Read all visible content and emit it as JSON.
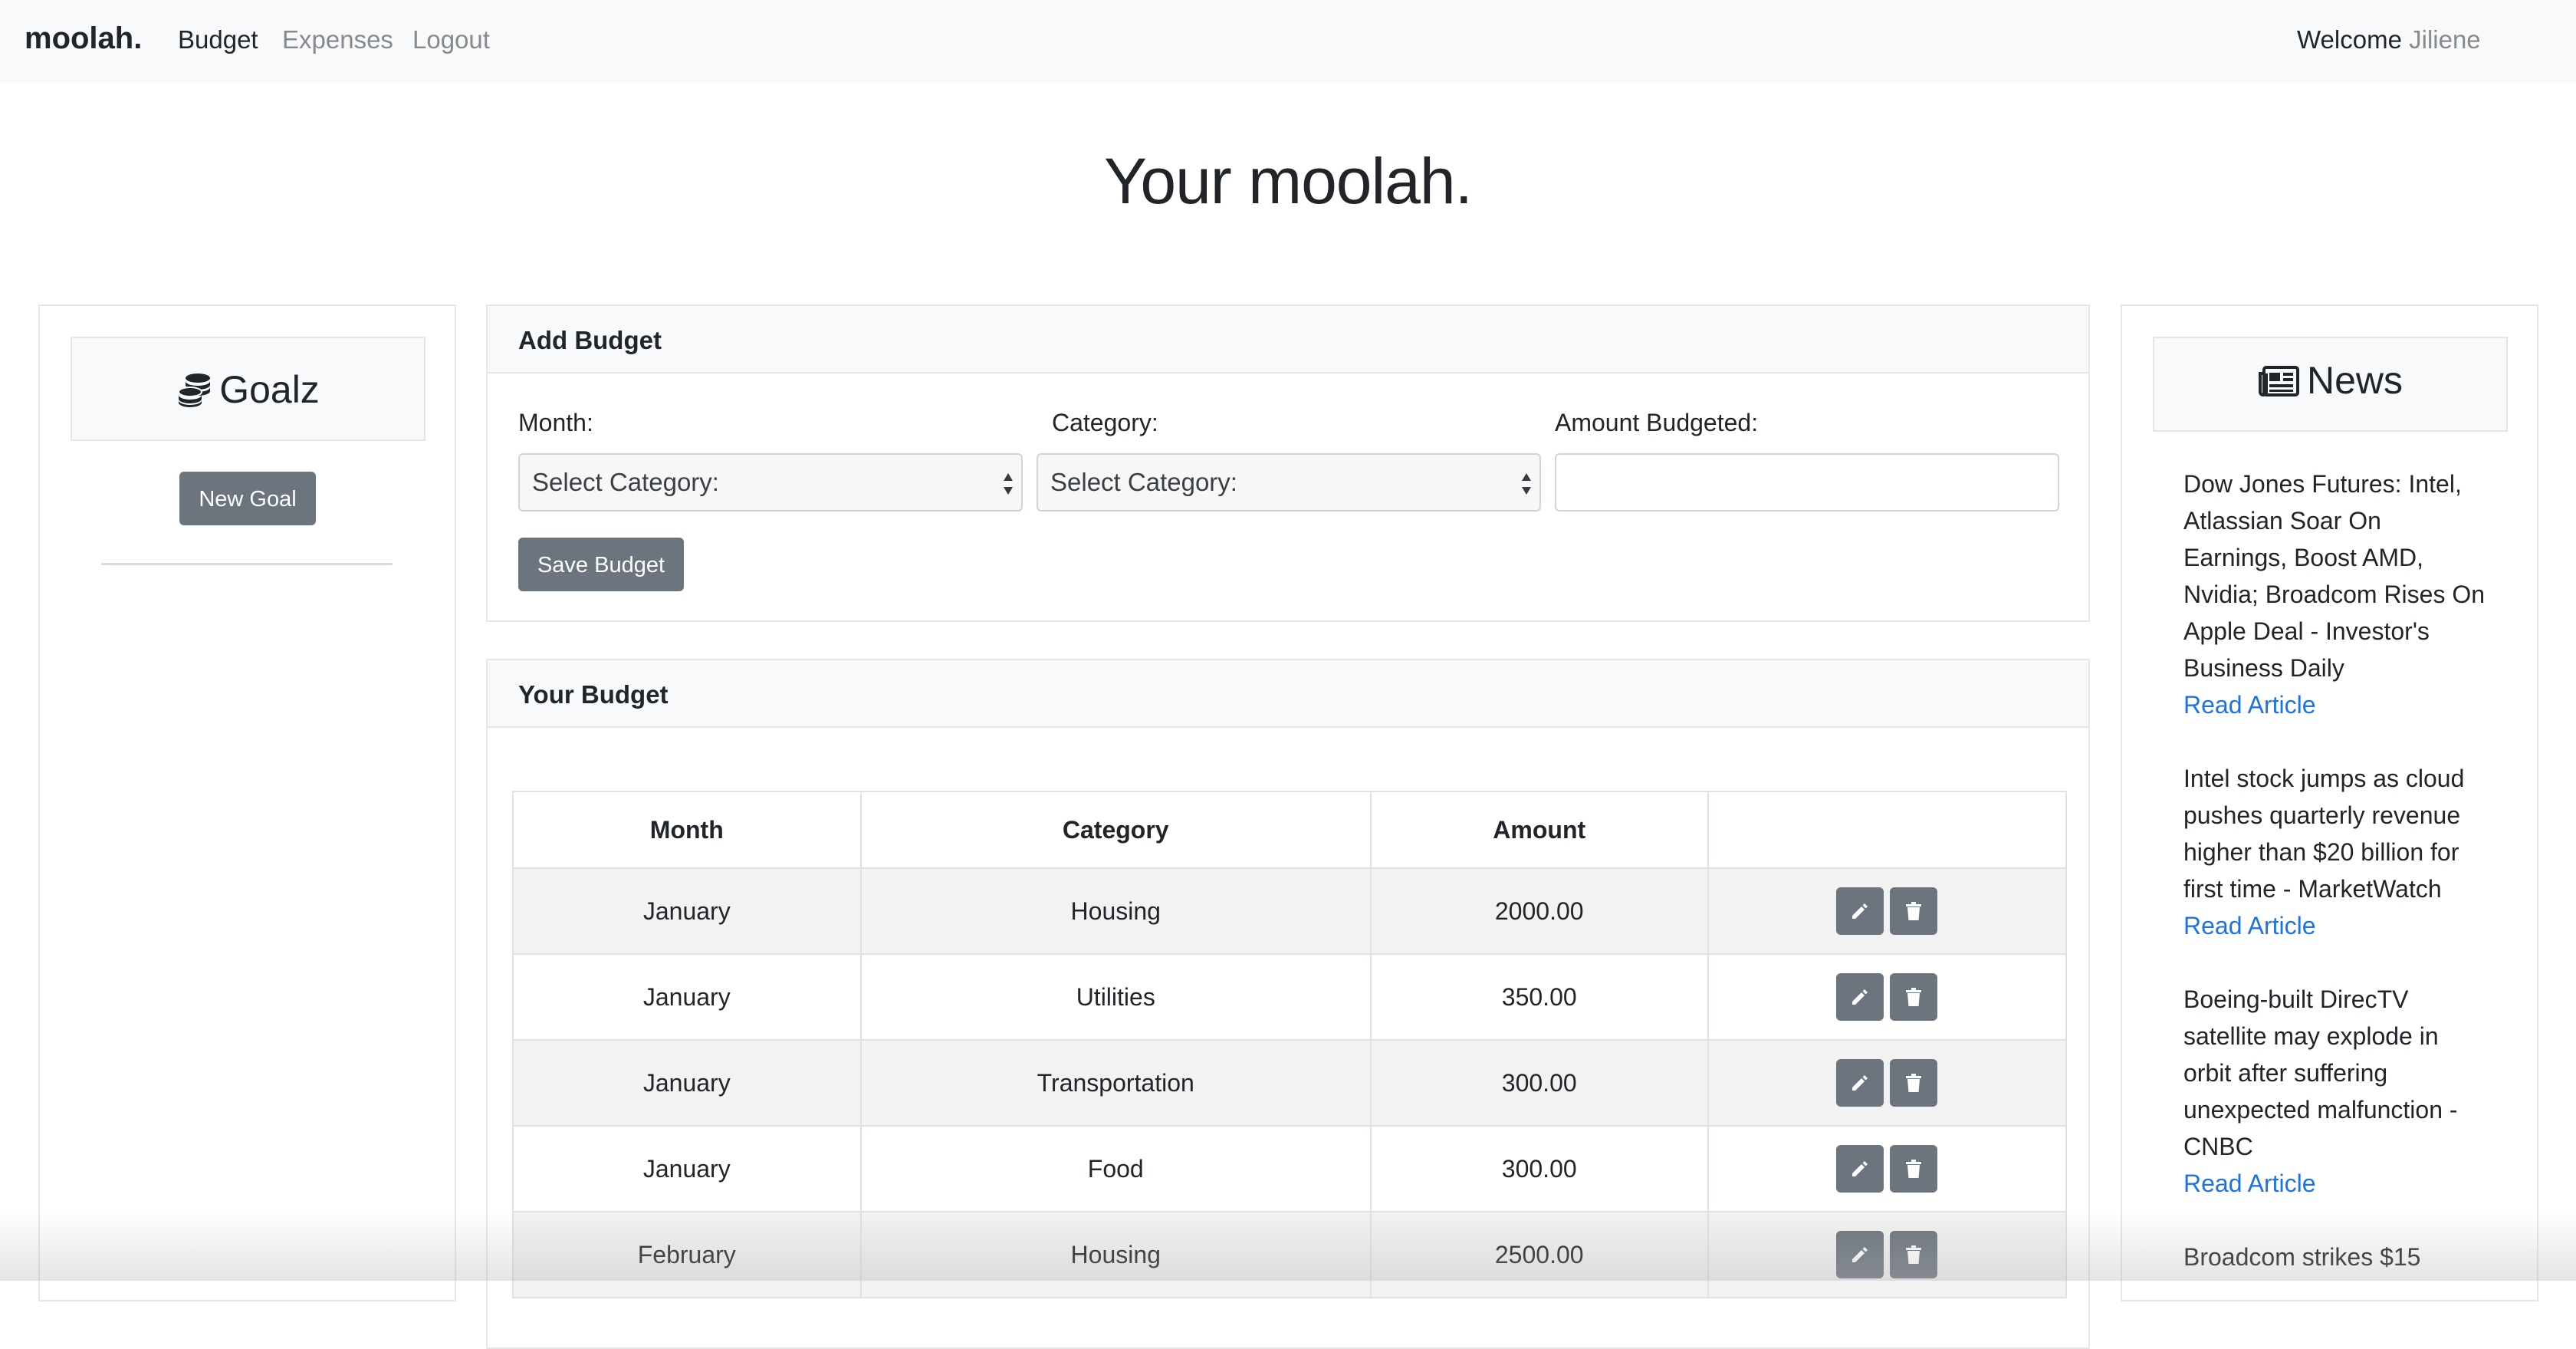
{
  "navbar": {
    "brand": "moolah.",
    "links": [
      "Budget",
      "Expenses",
      "Logout"
    ],
    "welcome_label": "Welcome",
    "username": "Jiliene"
  },
  "page_title": "Your moolah.",
  "goals": {
    "title": "Goalz",
    "new_goal_label": "New Goal"
  },
  "add_budget": {
    "title": "Add Budget",
    "month_label": "Month:",
    "month_select": "Select Category:",
    "category_label": "Category:",
    "category_select": "Select Category:",
    "amount_label": "Amount Budgeted:",
    "amount_value": "",
    "save_label": "Save Budget"
  },
  "budget": {
    "title": "Your Budget",
    "headers": [
      "Month",
      "Category",
      "Amount",
      ""
    ],
    "rows": [
      {
        "month": "January",
        "category": "Housing",
        "amount": "2000.00"
      },
      {
        "month": "January",
        "category": "Utilities",
        "amount": "350.00"
      },
      {
        "month": "January",
        "category": "Transportation",
        "amount": "300.00"
      },
      {
        "month": "January",
        "category": "Food",
        "amount": "300.00"
      },
      {
        "month": "February",
        "category": "Housing",
        "amount": "2500.00"
      }
    ]
  },
  "news": {
    "title": "News",
    "items": [
      {
        "headline": "Dow Jones Futures: Intel, Atlassian Soar On Earnings, Boost AMD, Nvidia; Broadcom Rises On Apple Deal - Investor's Business Daily",
        "link": "Read Article"
      },
      {
        "headline": "Intel stock jumps as cloud pushes quarterly revenue higher than $20 billion for first time - MarketWatch",
        "link": "Read Article"
      },
      {
        "headline": "Boeing-built DirecTV satellite may explode in orbit after suffering unexpected malfunction - CNBC",
        "link": "Read Article"
      },
      {
        "headline": "Broadcom strikes $15",
        "link": ""
      }
    ]
  },
  "colors": {
    "button_grey": "#6c757d",
    "link_blue": "#1a73e8",
    "navbar_bg": "#f8f9fa"
  }
}
